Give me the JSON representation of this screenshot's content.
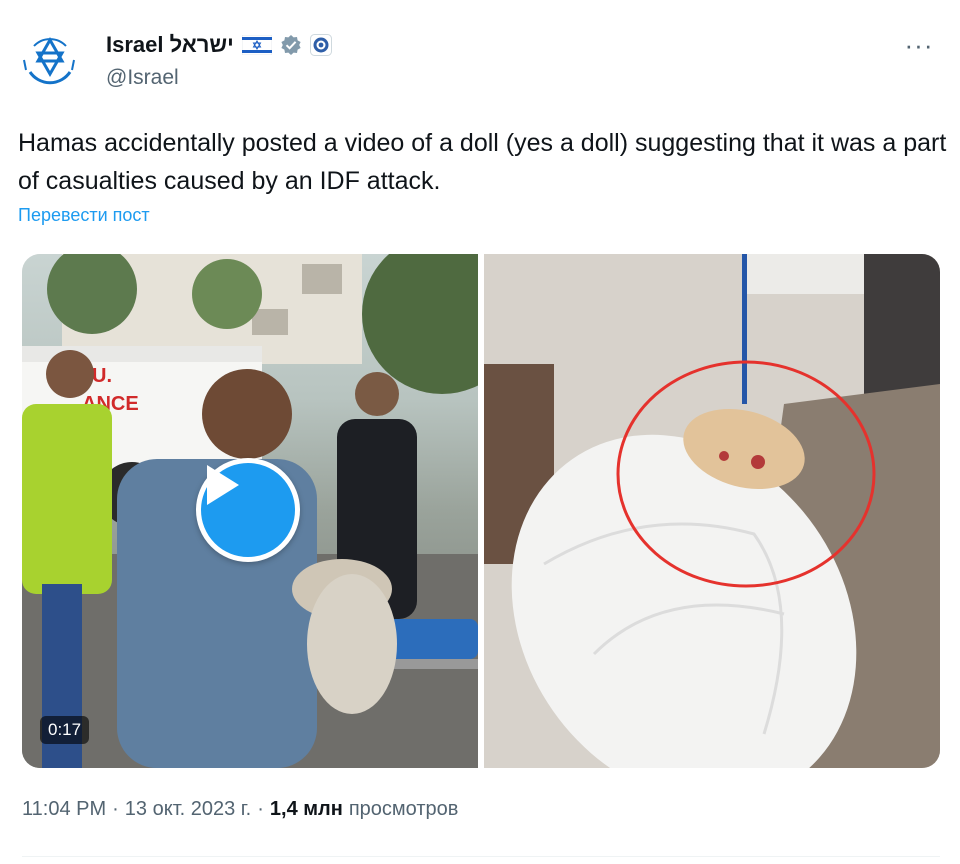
{
  "author": {
    "display_name": "Israel ישראל",
    "handle": "@Israel",
    "flag_icon": "israel-flag-icon",
    "verified_icon": "gray-verified-badge-icon",
    "affiliation_icon": "government-emblem-icon"
  },
  "more_label": "···",
  "tweet": {
    "text": "Hamas accidentally posted a video of a doll (yes a doll) suggesting that it was a part of casualties caused by an IDF attack.",
    "translate_label": "Перевести пост"
  },
  "media": {
    "left": {
      "type": "video",
      "ambulance_text_1": "U.",
      "ambulance_text_2": "ANCE",
      "duration": "0:17"
    },
    "right": {
      "type": "image"
    }
  },
  "meta": {
    "time": "11:04 PM",
    "separator": "·",
    "date": "13 окт. 2023 г.",
    "views_count": "1,4 млн",
    "views_label": "просмотров"
  },
  "colors": {
    "accent": "#1d9bf0",
    "text": "#0f1419",
    "muted": "#536471",
    "highlight_circle": "#e5322d"
  }
}
